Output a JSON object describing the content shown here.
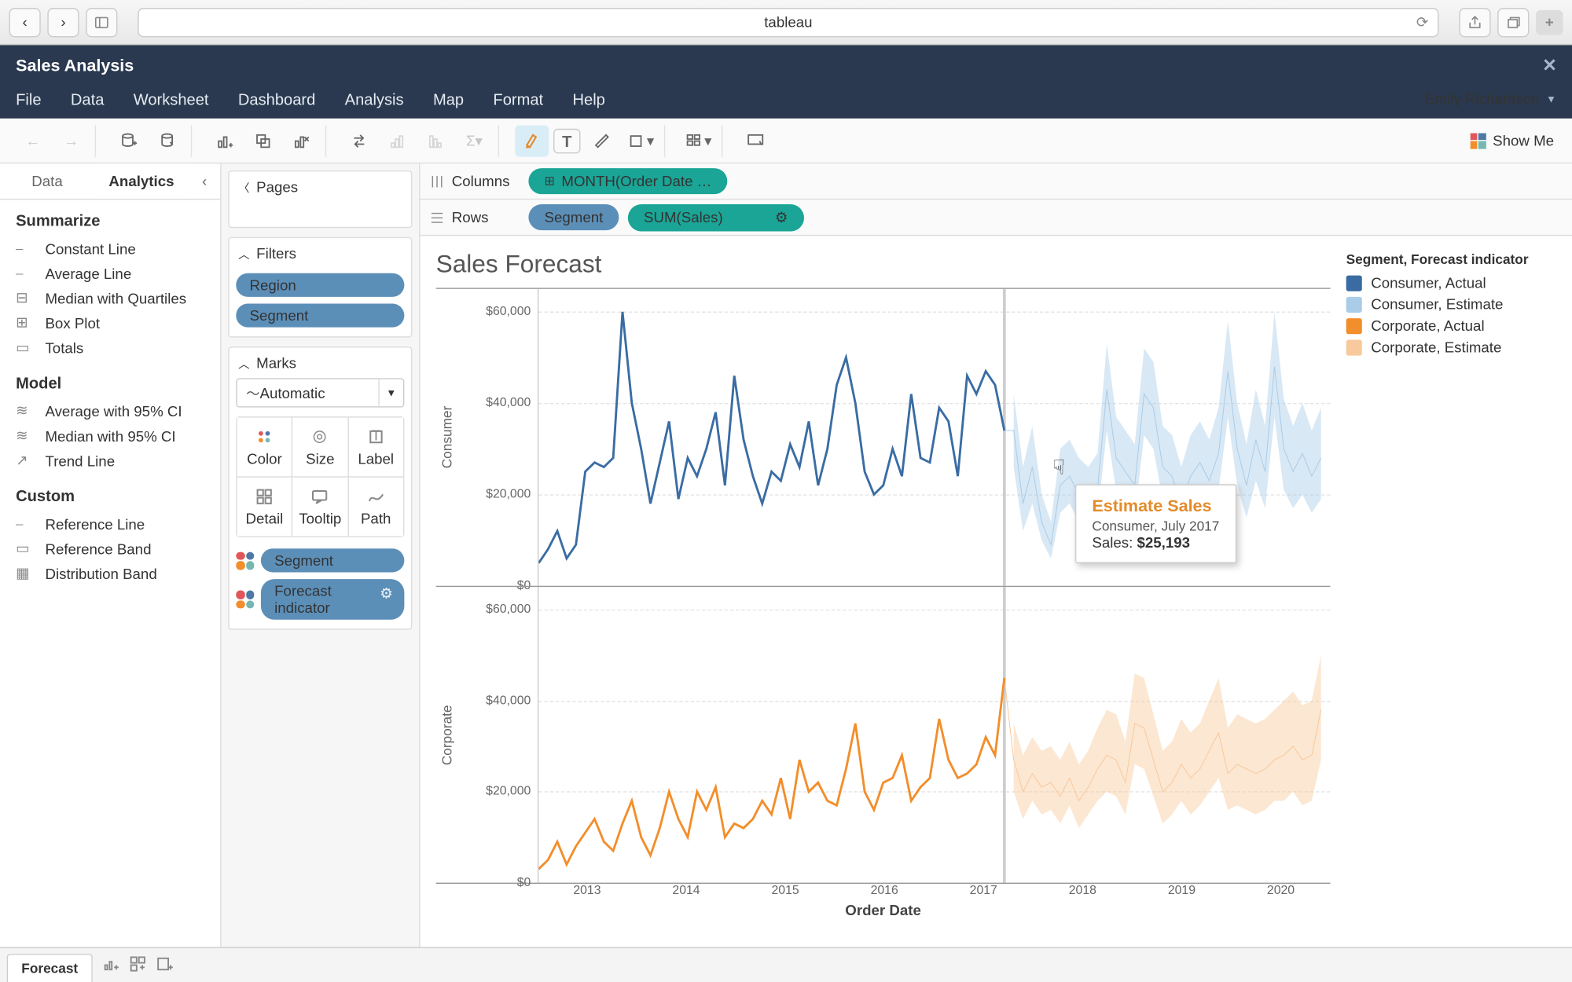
{
  "browser": {
    "url": "tableau"
  },
  "app": {
    "title": "Sales Analysis",
    "user": "Emily Richardson"
  },
  "menu": [
    "File",
    "Data",
    "Worksheet",
    "Dashboard",
    "Analysis",
    "Map",
    "Format",
    "Help"
  ],
  "showme": "Show Me",
  "side_tabs": {
    "data": "Data",
    "analytics": "Analytics"
  },
  "analytics": {
    "summarize_h": "Summarize",
    "summarize": [
      "Constant Line",
      "Average Line",
      "Median with Quartiles",
      "Box Plot",
      "Totals"
    ],
    "model_h": "Model",
    "model": [
      "Average with 95% CI",
      "Median with 95% CI",
      "Trend Line"
    ],
    "custom_h": "Custom",
    "custom": [
      "Reference Line",
      "Reference Band",
      "Distribution Band"
    ]
  },
  "cards": {
    "pages": "Pages",
    "filters": "Filters",
    "filter_items": [
      "Region",
      "Segment"
    ],
    "marks": "Marks",
    "marks_mode": "Automatic",
    "mark_btns": [
      "Color",
      "Size",
      "Label",
      "Detail",
      "Tooltip",
      "Path"
    ],
    "mark_pills": [
      "Segment",
      "Forecast indicator"
    ]
  },
  "shelves": {
    "columns": "Columns",
    "col_item": "MONTH(Order Date …",
    "rows": "Rows",
    "row_items": [
      "Segment",
      "SUM(Sales)"
    ]
  },
  "viz": {
    "title": "Sales Forecast",
    "row_labels": [
      "Consumer",
      "Corporate"
    ],
    "xlabel": "Order Date",
    "xticks": [
      "2013",
      "2014",
      "2015",
      "2016",
      "2017",
      "2018",
      "2019",
      "2020"
    ],
    "yticks": [
      "$0",
      "$20,000",
      "$40,000",
      "$60,000"
    ]
  },
  "legend": {
    "title": "Segment, Forecast indicator",
    "items": [
      {
        "label": "Consumer, Actual",
        "color": "#3a6ca3"
      },
      {
        "label": "Consumer, Estimate",
        "color": "#a9cce8"
      },
      {
        "label": "Corporate, Actual",
        "color": "#f28e2b"
      },
      {
        "label": "Corporate, Estimate",
        "color": "#f8c99c"
      }
    ]
  },
  "tooltip": {
    "t1": "Estimate Sales",
    "t2": "Consumer, July 2017",
    "t3a": "Sales: ",
    "t3b": "$25,193"
  },
  "footer": {
    "tab": "Forecast"
  },
  "chart_data": {
    "type": "line",
    "title": "Sales Forecast",
    "xlabel": "Order Date",
    "ylabel": "Sales",
    "ylim": [
      0,
      65000
    ],
    "x_years": [
      2013,
      2014,
      2015,
      2016,
      2017,
      2018,
      2019,
      2020
    ],
    "facets": [
      "Consumer",
      "Corporate"
    ],
    "series": [
      {
        "name": "Consumer, Actual",
        "facet": "Consumer",
        "color": "#3a6ca3",
        "y": [
          5000,
          8000,
          12000,
          6000,
          9000,
          25000,
          27000,
          26000,
          28000,
          60000,
          40000,
          30000,
          18000,
          27000,
          36000,
          19000,
          28000,
          24000,
          30000,
          38000,
          22000,
          46000,
          32000,
          24000,
          18000,
          25000,
          23000,
          31000,
          26000,
          36000,
          22000,
          30000,
          44000,
          50000,
          40000,
          25000,
          20000,
          22000,
          30000,
          24000,
          42000,
          28000,
          27000,
          39000,
          36000,
          24000,
          46000,
          42000,
          47000,
          44000,
          34000
        ]
      },
      {
        "name": "Consumer, Estimate",
        "facet": "Consumer",
        "color": "#a9cce8",
        "y": [
          34000,
          18000,
          26000,
          14000,
          9000,
          22000,
          24000,
          20000,
          18000,
          21000,
          43000,
          28000,
          25000,
          22000,
          42000,
          39000,
          26000,
          24000,
          18000,
          24000,
          27000,
          23000,
          29000,
          47000,
          30000,
          22000,
          32000,
          25000,
          48000,
          30000,
          25000,
          29000,
          24000,
          28000
        ],
        "band_lo": [
          26000,
          12000,
          18000,
          10000,
          6000,
          16000,
          18000,
          14000,
          12000,
          15000,
          34000,
          21000,
          18000,
          15000,
          33000,
          30000,
          19000,
          17000,
          12000,
          17000,
          20000,
          16000,
          21000,
          37000,
          22000,
          15000,
          23000,
          17000,
          37000,
          21000,
          17000,
          20000,
          16000,
          19000
        ],
        "band_hi": [
          42000,
          26000,
          35000,
          20000,
          14000,
          30000,
          32000,
          28000,
          26000,
          29000,
          53000,
          37000,
          34000,
          31000,
          52000,
          49000,
          35000,
          33000,
          26000,
          33000,
          36000,
          32000,
          39000,
          58000,
          40000,
          31000,
          43000,
          35000,
          60000,
          41000,
          35000,
          40000,
          34000,
          39000
        ]
      },
      {
        "name": "Corporate, Actual",
        "facet": "Corporate",
        "color": "#f28e2b",
        "y": [
          3000,
          5000,
          9000,
          4000,
          8000,
          11000,
          14000,
          9000,
          7000,
          13000,
          18000,
          10000,
          6000,
          12000,
          20000,
          14000,
          10000,
          20000,
          16000,
          21000,
          10000,
          13000,
          12000,
          14000,
          18000,
          15000,
          23000,
          14000,
          27000,
          20000,
          22000,
          18000,
          17000,
          25000,
          35000,
          20000,
          16000,
          22000,
          23000,
          28000,
          18000,
          21000,
          23000,
          36000,
          27000,
          23000,
          24000,
          26000,
          32000,
          28000,
          45000
        ]
      },
      {
        "name": "Corporate, Estimate",
        "facet": "Corporate",
        "color": "#f8c99c",
        "y": [
          27000,
          20000,
          24000,
          21000,
          22000,
          19000,
          23000,
          18000,
          21000,
          25000,
          28000,
          27000,
          22000,
          35000,
          34000,
          27000,
          20000,
          22000,
          26000,
          23000,
          25000,
          29000,
          33000,
          24000,
          26000,
          25000,
          24000,
          25000,
          27000,
          28000,
          30000,
          27000,
          28000,
          38000
        ],
        "band_lo": [
          20000,
          14000,
          18000,
          15000,
          16000,
          13000,
          17000,
          12000,
          15000,
          18000,
          20000,
          19000,
          15000,
          26000,
          25000,
          19000,
          13000,
          15000,
          18000,
          15000,
          17000,
          20000,
          23000,
          16000,
          17000,
          16000,
          15000,
          16000,
          18000,
          18000,
          20000,
          17000,
          18000,
          27000
        ],
        "band_hi": [
          35000,
          28000,
          32000,
          29000,
          30000,
          27000,
          31000,
          26000,
          29000,
          34000,
          38000,
          37000,
          31000,
          46000,
          45000,
          37000,
          29000,
          31000,
          36000,
          33000,
          35000,
          40000,
          45000,
          34000,
          37000,
          36000,
          35000,
          36000,
          38000,
          40000,
          42000,
          39000,
          40000,
          50000
        ]
      }
    ]
  }
}
